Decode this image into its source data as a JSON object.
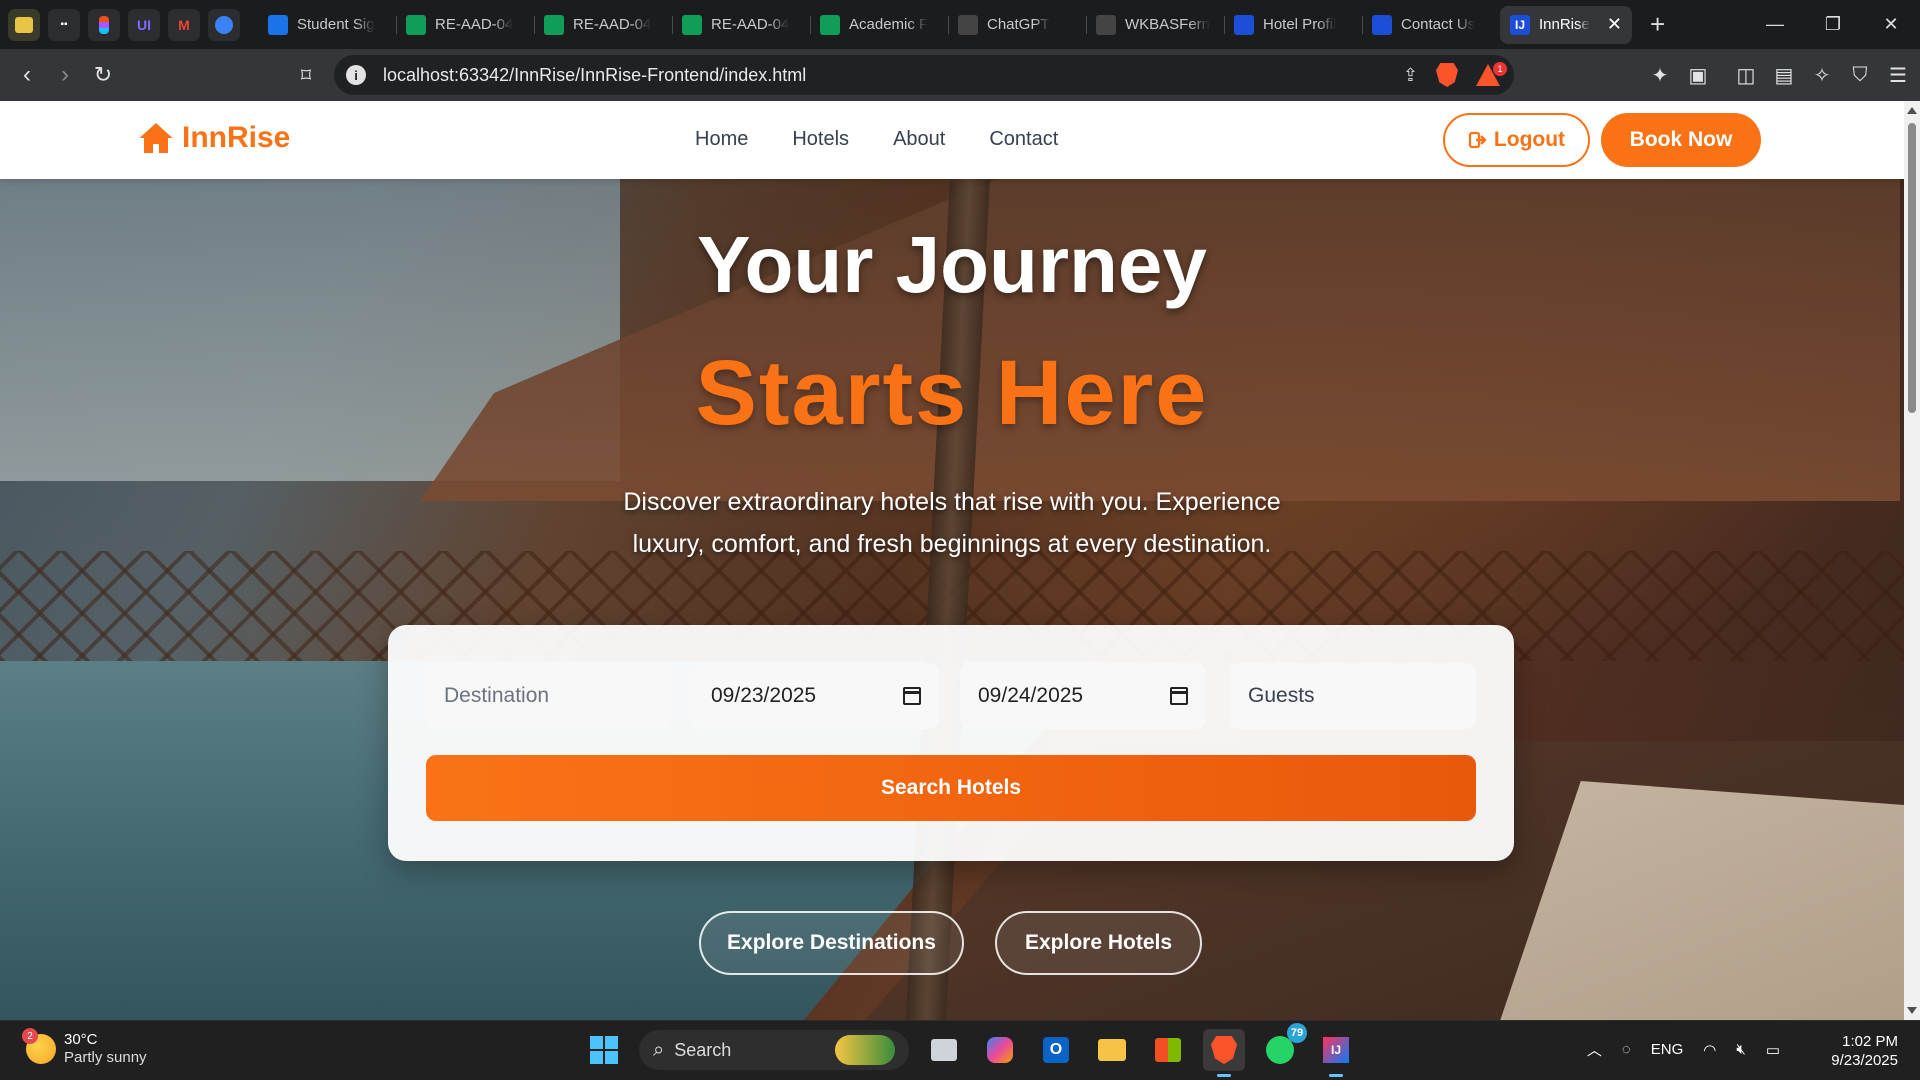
{
  "browser": {
    "pinned": [
      "",
      "",
      "",
      "UI",
      "M",
      ""
    ],
    "tabs": [
      {
        "title": "Student Sig",
        "fav_color": "#1a73e8",
        "icon": "drive-icon"
      },
      {
        "title": "RE-AAD-04",
        "fav_color": "#0f9d58",
        "icon": "sheets-icon"
      },
      {
        "title": "RE-AAD-04",
        "fav_color": "#0f9d58",
        "icon": "sheets-icon"
      },
      {
        "title": "RE-AAD-04",
        "fav_color": "#0f9d58",
        "icon": "sheets-icon"
      },
      {
        "title": "Academic F",
        "fav_color": "#0f9d58",
        "icon": "sheets-icon"
      },
      {
        "title": "ChatGPT",
        "fav_color": "#444",
        "icon": "chatgpt-icon"
      },
      {
        "title": "WKBASFern",
        "fav_color": "#444",
        "icon": "github-icon"
      },
      {
        "title": "Hotel Profil",
        "fav_color": "#1d4ed8",
        "icon": "intellij-icon"
      },
      {
        "title": "Contact Us",
        "fav_color": "#1d4ed8",
        "icon": "intellij-icon"
      }
    ],
    "active_tab": {
      "title": "InnRise",
      "close": "✕"
    },
    "new_tab": "+",
    "url": "localhost:63342/InnRise/InnRise-Frontend/index.html",
    "rewards_badge": "1"
  },
  "nav": {
    "brand": "InnRise",
    "links": [
      "Home",
      "Hotels",
      "About",
      "Contact"
    ],
    "logout": "Logout",
    "book": "Book Now",
    "accent": "#f97316"
  },
  "hero": {
    "line1": "Your Journey",
    "line2": "Starts Here",
    "lead": "Discover extraordinary hotels that rise with you. Experience luxury, comfort, and fresh beginnings at every destination."
  },
  "search": {
    "destination_placeholder": "Destination",
    "checkin": "09/23/2025",
    "checkout": "09/24/2025",
    "guests_placeholder": "Guests",
    "button": "Search Hotels"
  },
  "cta": {
    "destinations": "Explore Destinations",
    "hotels": "Explore Hotels"
  },
  "taskbar": {
    "weather_badge": "2",
    "temp": "30°C",
    "condition": "Partly sunny",
    "search": "Search",
    "whatsapp_badge": "79",
    "lang": "ENG",
    "time": "1:02 PM",
    "date": "9/23/2025"
  }
}
